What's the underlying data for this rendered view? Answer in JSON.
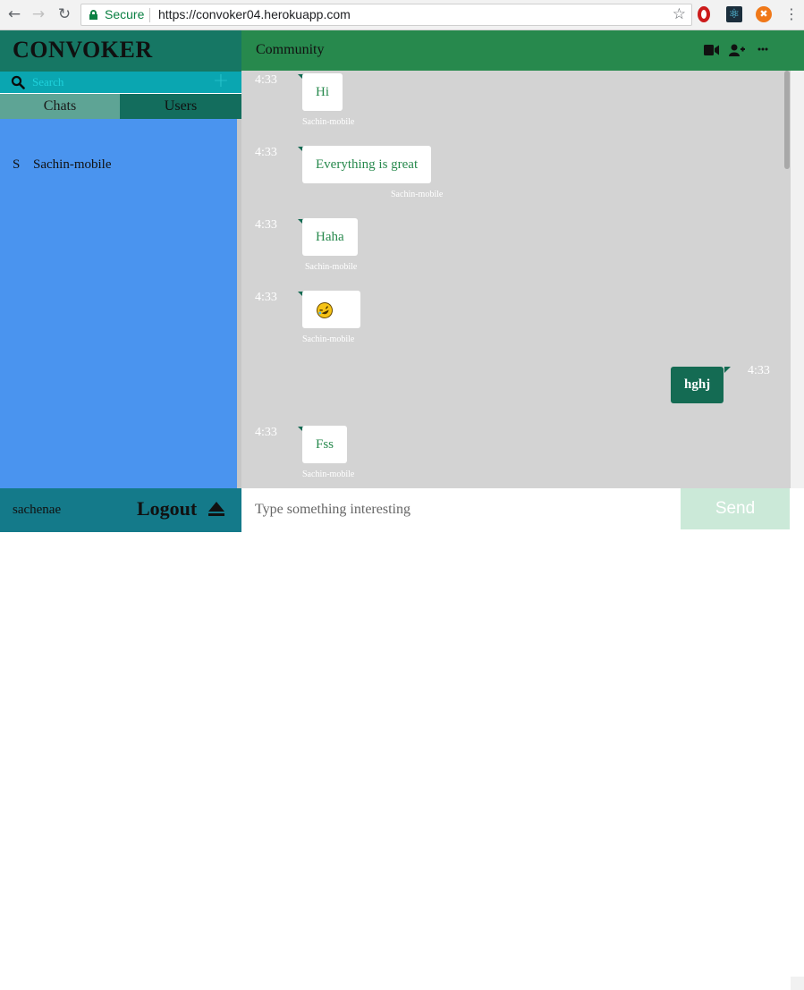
{
  "browser": {
    "secure_label": "Secure",
    "url": "https://convoker04.herokuapp.com"
  },
  "sidebar": {
    "brand": "CONVOKER",
    "search_placeholder": "Search",
    "add_label": "+",
    "tabs": [
      {
        "label": "Chats",
        "active": true
      },
      {
        "label": "Users",
        "active": false
      }
    ],
    "chats": [
      {
        "initial": "S",
        "name": "Sachin-mobile"
      }
    ],
    "username": "sachenae",
    "logout_label": "Logout"
  },
  "main": {
    "room_title": "Community",
    "messages": [
      {
        "time": "4:33",
        "text": "Hi",
        "sender": "Sachin-mobile",
        "own": false
      },
      {
        "time": "4:33",
        "text": "Everything is great",
        "sender": "Sachin-mobile",
        "own": false
      },
      {
        "time": "4:33",
        "text": "Haha",
        "sender": "Sachin-mobile",
        "own": false
      },
      {
        "time": "4:33",
        "text": "",
        "emoji": "rolling-on-floor-laughing",
        "sender": "Sachin-mobile",
        "own": false
      },
      {
        "time": "4:33",
        "text": "hghj",
        "sender": "",
        "own": true
      },
      {
        "time": "4:33",
        "text": "Fss",
        "sender": "Sachin-mobile",
        "own": false
      }
    ],
    "composer_placeholder": "Type something interesting",
    "send_label": "Send"
  },
  "colors": {
    "header_green": "#27894d",
    "brand_bar": "#167764",
    "search_bar": "#0aa6b1",
    "chat_list_bg": "#4a94ef",
    "own_bubble": "#146b53",
    "message_area": "#d3d3d3",
    "send_button": "#cbe9d8"
  }
}
